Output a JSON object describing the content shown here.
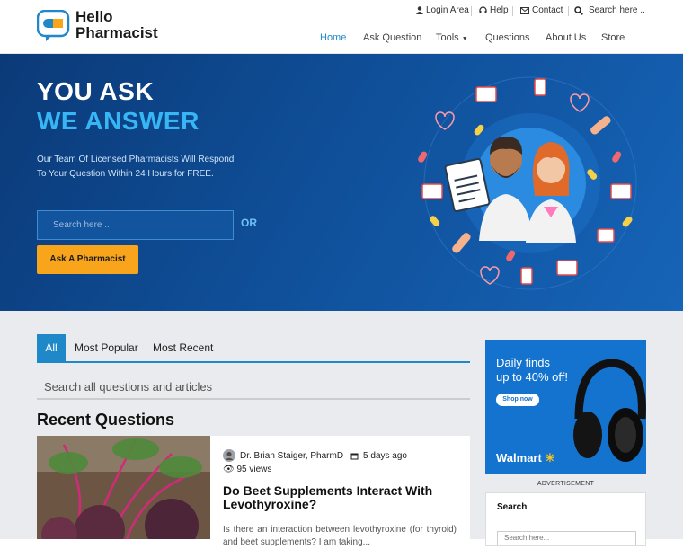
{
  "brand": {
    "line1": "Hello",
    "line2": "Pharmacist",
    "primary_color": "#1e88c9",
    "accent_color": "#f8a51b"
  },
  "utility": {
    "login": "Login Area",
    "help": "Help",
    "contact": "Contact",
    "search": "Search here .."
  },
  "nav": [
    "Home",
    "Ask Question",
    "Tools",
    "Questions",
    "About Us",
    "Store"
  ],
  "hero": {
    "title1": "YOU ASK",
    "title2": "WE ANSWER",
    "lead": "Our Team Of Licensed Pharmacists Will Respond To Your Question Within 24 Hours for FREE.",
    "search_placeholder": "Search here ..",
    "or": "OR",
    "ask_button": "Ask A Pharmacist"
  },
  "tabs": [
    "All",
    "Most Popular",
    "Most Recent"
  ],
  "question_search": "Search all questions and articles",
  "recent_heading": "Recent Questions",
  "card": {
    "author": "Dr. Brian Staiger, PharmD",
    "time": "5 days ago",
    "views": "95 views",
    "title": "Do Beet Supplements Interact With Levothyroxine?",
    "excerpt": "Is there an interaction between levothyroxine (for thyroid) and beet supplements? I am taking..."
  },
  "ad": {
    "headline1": "Daily finds",
    "headline2": "up to 40% off!",
    "button": "Shop now",
    "brand": "Walmart",
    "label": "ADVERTISEMENT"
  },
  "widget": {
    "title": "Search",
    "placeholder": "Search here..."
  }
}
